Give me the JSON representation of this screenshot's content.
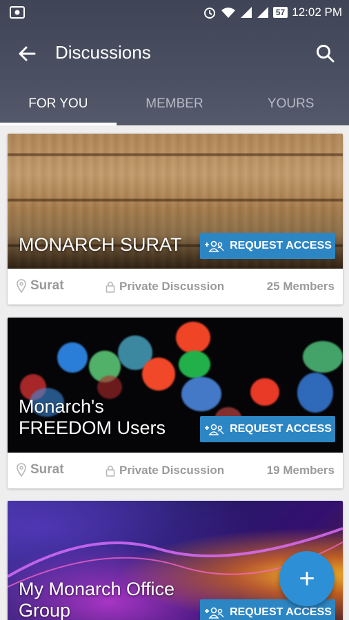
{
  "status_bar": {
    "time": "12:02 PM",
    "battery": "57"
  },
  "toolbar": {
    "title": "Discussions"
  },
  "tabs": [
    {
      "label": "FOR YOU",
      "active": true
    },
    {
      "label": "MEMBER",
      "active": false
    },
    {
      "label": "YOURS",
      "active": false
    }
  ],
  "discussions": [
    {
      "title": "MONARCH SURAT",
      "button": "REQUEST ACCESS",
      "location": "Surat",
      "type": "Private Discussion",
      "members": "25 Members"
    },
    {
      "title_line1": "Monarch's",
      "title_line2": "FREEDOM Users",
      "button": "REQUEST ACCESS",
      "location": "Surat",
      "type": "Private Discussion",
      "members": "19 Members"
    },
    {
      "title_line1": "My Monarch Office",
      "title_line2": "Group",
      "button": "REQUEST ACCESS"
    }
  ],
  "fab": {
    "label": "+"
  },
  "colors": {
    "appbar": "#4a5061",
    "accent": "#2d86c4",
    "fab": "#2d8fd6"
  }
}
